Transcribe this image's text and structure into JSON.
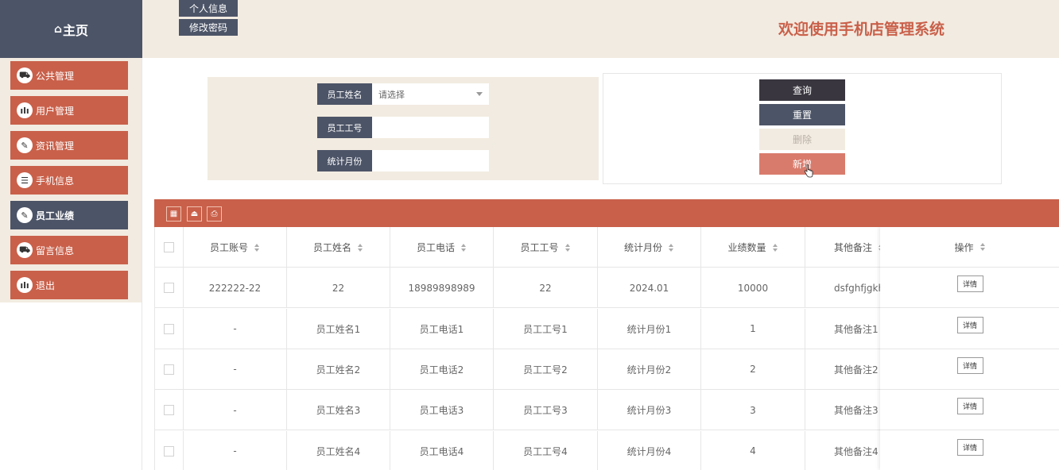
{
  "header": {
    "home_icon": "⌂",
    "home_label": "主页",
    "buttons": [
      "个人信息",
      "修改密码"
    ],
    "welcome": "欢迎使用手机店管理系统"
  },
  "sidebar": {
    "items": [
      {
        "label": "公共管理",
        "icon": "car-icon",
        "glyph": "⛟",
        "active": false
      },
      {
        "label": "用户管理",
        "icon": "bars-icon",
        "glyph": "ılı",
        "active": false
      },
      {
        "label": "资讯管理",
        "icon": "edit-icon",
        "glyph": "✎",
        "active": false
      },
      {
        "label": "手机信息",
        "icon": "clipboard-icon",
        "glyph": "☰",
        "active": false
      },
      {
        "label": "员工业绩",
        "icon": "edit-icon",
        "glyph": "✎",
        "active": true
      },
      {
        "label": "留言信息",
        "icon": "car-icon",
        "glyph": "⛟",
        "active": false
      },
      {
        "label": "退出",
        "icon": "bars-icon",
        "glyph": "ılı",
        "active": false
      }
    ]
  },
  "search": {
    "name_label": "员工姓名",
    "name_placeholder": "请选择",
    "id_label": "员工工号",
    "id_value": "",
    "month_label": "统计月份",
    "month_value": ""
  },
  "actions": {
    "query": "查询",
    "reset": "重置",
    "delete": "删除",
    "add": "新增"
  },
  "toolbar": {
    "icons": [
      "grid-icon",
      "export-icon",
      "print-icon"
    ]
  },
  "table": {
    "columns": [
      "员工账号",
      "员工姓名",
      "员工电话",
      "员工工号",
      "统计月份",
      "业绩数量",
      "其他备注"
    ],
    "op_column": "操作",
    "detail_label": "详情",
    "rows": [
      [
        "222222-22",
        "22",
        "18989898989",
        "22",
        "2024.01",
        "10000",
        "dsfghfjgkhl"
      ],
      [
        "-",
        "员工姓名1",
        "员工电话1",
        "员工工号1",
        "统计月份1",
        "1",
        "其他备注1"
      ],
      [
        "-",
        "员工姓名2",
        "员工电话2",
        "员工工号2",
        "统计月份2",
        "2",
        "其他备注2"
      ],
      [
        "-",
        "员工姓名3",
        "员工电话3",
        "员工工号3",
        "统计月份3",
        "3",
        "其他备注3"
      ],
      [
        "-",
        "员工姓名4",
        "员工电话4",
        "员工工号4",
        "统计月份4",
        "4",
        "其他备注4"
      ]
    ]
  },
  "colors": {
    "accent": "#c9604a",
    "navy": "#4c5467",
    "beige": "#f2ebe1",
    "query_btn": "#39363f",
    "add_btn": "#d97b6c"
  }
}
